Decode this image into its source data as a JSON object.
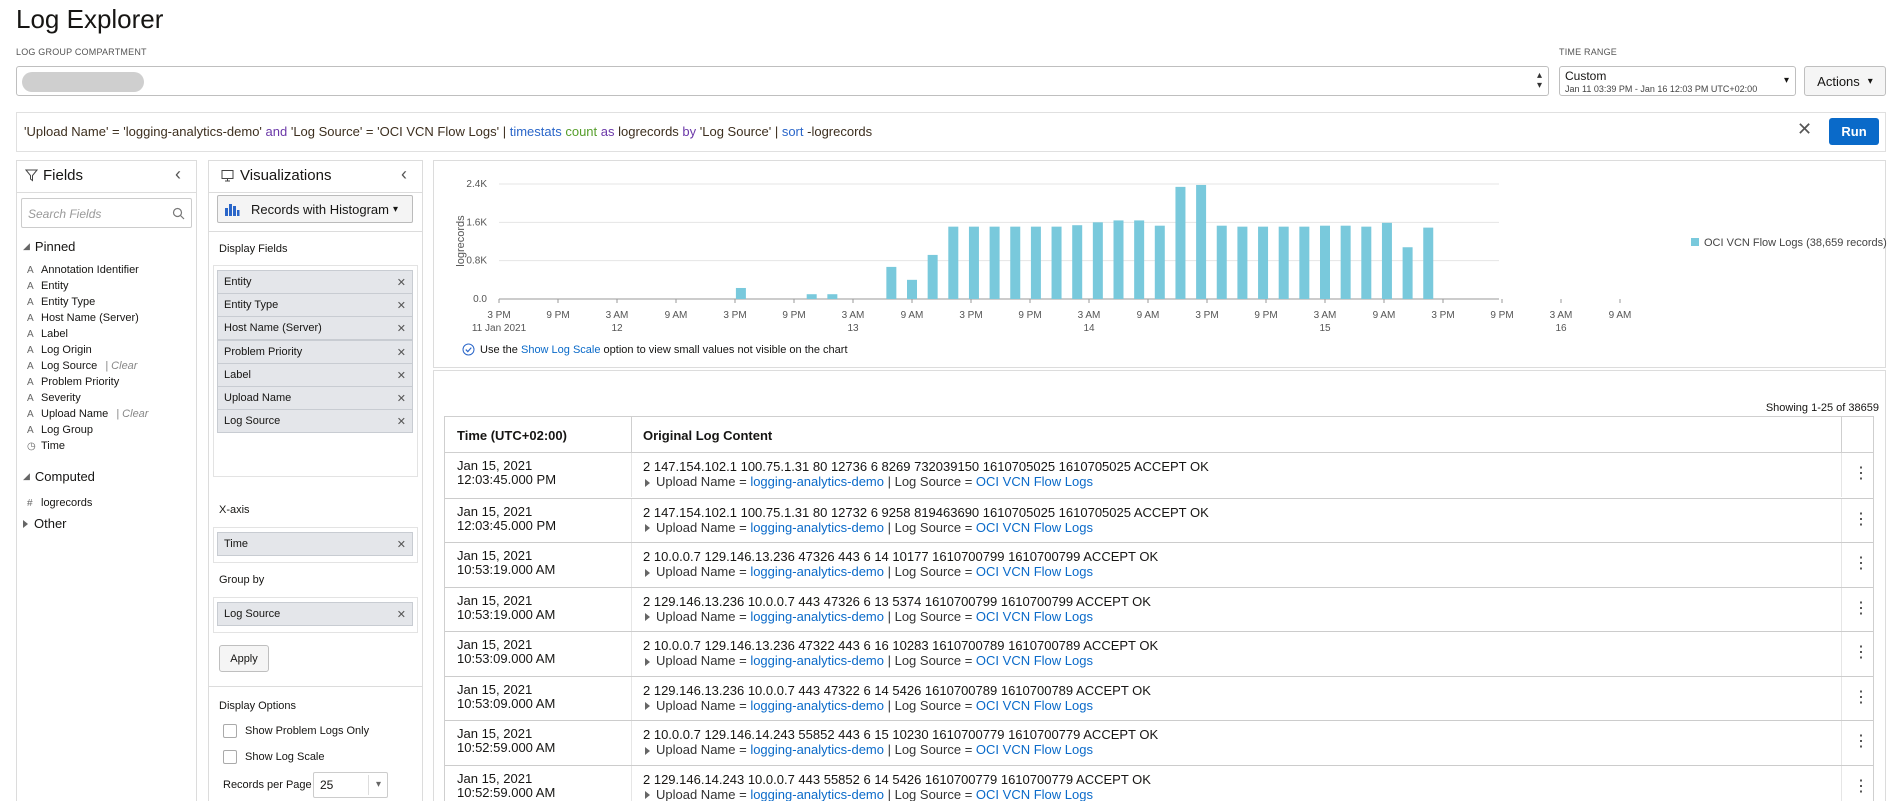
{
  "page_title": "Log Explorer",
  "compartment": {
    "caption": "LOG GROUP COMPARTMENT"
  },
  "time_range": {
    "caption": "TIME RANGE",
    "value": "Custom",
    "detail": "Jan 11 03:39 PM - Jan 16 12:03 PM UTC+02:00"
  },
  "actions_label": "Actions",
  "query": {
    "parts": [
      {
        "t": "'Upload Name' = 'logging-analytics-demo' ",
        "c": "q-str"
      },
      {
        "t": "and ",
        "c": "q-kw"
      },
      {
        "t": "'Log Source' = 'OCI VCN Flow Logs' | ",
        "c": "q-str"
      },
      {
        "t": "timestats ",
        "c": "q-cmd"
      },
      {
        "t": "count ",
        "c": "q-fn"
      },
      {
        "t": "as ",
        "c": "q-kw"
      },
      {
        "t": "logrecords ",
        "c": "q-str"
      },
      {
        "t": "by ",
        "c": "q-kw"
      },
      {
        "t": "'Log Source' | ",
        "c": "q-str"
      },
      {
        "t": "sort ",
        "c": "q-cmd"
      },
      {
        "t": "-logrecords",
        "c": "q-str"
      }
    ],
    "run_label": "Run"
  },
  "fields_panel": {
    "title": "Fields",
    "search_placeholder": "Search Fields",
    "pinned_label": "Pinned",
    "pinned": [
      {
        "name": "Annotation Identifier",
        "type": "A"
      },
      {
        "name": "Entity",
        "type": "A"
      },
      {
        "name": "Entity Type",
        "type": "A"
      },
      {
        "name": "Host Name (Server)",
        "type": "A"
      },
      {
        "name": "Label",
        "type": "A"
      },
      {
        "name": "Log Origin",
        "type": "A"
      },
      {
        "name": "Log Source",
        "type": "A",
        "clear": "| Clear"
      },
      {
        "name": "Problem Priority",
        "type": "A"
      },
      {
        "name": "Severity",
        "type": "A"
      },
      {
        "name": "Upload Name",
        "type": "A",
        "clear": "| Clear"
      },
      {
        "name": "Log Group",
        "type": "A"
      },
      {
        "name": "Time",
        "type": "◷"
      }
    ],
    "computed_label": "Computed",
    "computed": [
      {
        "name": "logrecords",
        "type": "#"
      }
    ],
    "other_label": "Other"
  },
  "viz_panel": {
    "title": "Visualizations",
    "viz_type": "Records with Histogram",
    "display_fields_label": "Display Fields",
    "display_fields": [
      "Entity",
      "Entity Type",
      "Host Name (Server)",
      "Problem Priority",
      "Label",
      "Upload Name",
      "Log Source"
    ],
    "x_axis_label": "X-axis",
    "x_axis_value": "Time",
    "group_by_label": "Group by",
    "group_by_value": "Log Source",
    "apply_label": "Apply",
    "display_options_label": "Display Options",
    "show_problem_logs": "Show Problem Logs Only",
    "show_log_scale": "Show Log Scale",
    "records_per_page_label": "Records per Page",
    "records_per_page": "25"
  },
  "chart_note": {
    "prefix": "Use the ",
    "link": "Show Log Scale",
    "suffix": " option to view small values not visible on the chart"
  },
  "chart_data": {
    "type": "bar",
    "ylabel": "logrecords",
    "yticks": [
      "0.0",
      "0.8K",
      "1.6K",
      "2.4K"
    ],
    "ylim": [
      0,
      2400
    ],
    "series": [
      {
        "name": "OCI VCN Flow Logs (38,659 records)",
        "color": "#79c9dc"
      }
    ],
    "xticks": [
      {
        "label": "3 PM",
        "sub": "11 Jan 2021"
      },
      {
        "label": "9 PM",
        "sub": ""
      },
      {
        "label": "3 AM",
        "sub": "12"
      },
      {
        "label": "9 AM",
        "sub": ""
      },
      {
        "label": "3 PM",
        "sub": ""
      },
      {
        "label": "9 PM",
        "sub": ""
      },
      {
        "label": "3 AM",
        "sub": "13"
      },
      {
        "label": "9 AM",
        "sub": ""
      },
      {
        "label": "3 PM",
        "sub": ""
      },
      {
        "label": "9 PM",
        "sub": ""
      },
      {
        "label": "3 AM",
        "sub": "14"
      },
      {
        "label": "9 AM",
        "sub": ""
      },
      {
        "label": "3 PM",
        "sub": ""
      },
      {
        "label": "9 PM",
        "sub": ""
      },
      {
        "label": "3 AM",
        "sub": "15"
      },
      {
        "label": "9 AM",
        "sub": ""
      },
      {
        "label": "3 PM",
        "sub": ""
      },
      {
        "label": "9 PM",
        "sub": ""
      },
      {
        "label": "3 AM",
        "sub": "16"
      },
      {
        "label": "9 AM",
        "sub": ""
      }
    ],
    "bars": [
      {
        "x": 4.1,
        "v": 230
      },
      {
        "x": 5.3,
        "v": 100
      },
      {
        "x": 5.65,
        "v": 100
      },
      {
        "x": 6.65,
        "v": 670
      },
      {
        "x": 7.0,
        "v": 400
      },
      {
        "x": 7.35,
        "v": 920
      },
      {
        "x": 7.7,
        "v": 1510
      },
      {
        "x": 8.05,
        "v": 1510
      },
      {
        "x": 8.4,
        "v": 1510
      },
      {
        "x": 8.75,
        "v": 1510
      },
      {
        "x": 9.1,
        "v": 1510
      },
      {
        "x": 9.45,
        "v": 1510
      },
      {
        "x": 9.8,
        "v": 1540
      },
      {
        "x": 10.15,
        "v": 1600
      },
      {
        "x": 10.5,
        "v": 1640
      },
      {
        "x": 10.85,
        "v": 1640
      },
      {
        "x": 11.2,
        "v": 1530
      },
      {
        "x": 11.55,
        "v": 2340
      },
      {
        "x": 11.9,
        "v": 2380
      },
      {
        "x": 12.25,
        "v": 1530
      },
      {
        "x": 12.6,
        "v": 1510
      },
      {
        "x": 12.95,
        "v": 1510
      },
      {
        "x": 13.3,
        "v": 1510
      },
      {
        "x": 13.65,
        "v": 1510
      },
      {
        "x": 14.0,
        "v": 1530
      },
      {
        "x": 14.35,
        "v": 1530
      },
      {
        "x": 14.7,
        "v": 1510
      },
      {
        "x": 15.05,
        "v": 1590
      },
      {
        "x": 15.4,
        "v": 1080
      },
      {
        "x": 15.75,
        "v": 1490
      }
    ]
  },
  "table": {
    "showing": "Showing 1-25 of 38659",
    "col_time": "Time (UTC+02:00)",
    "col_content": "Original Log Content",
    "meta_upload_key": "Upload Name = ",
    "meta_upload_val": "logging-analytics-demo",
    "meta_sep": " | Log Source = ",
    "meta_source_val": "OCI VCN Flow Logs",
    "rows": [
      {
        "time": "Jan 15, 2021 12:03:45.000 PM",
        "raw": "2 147.154.102.1 100.75.1.31 80 12736 6 8269 732039150 1610705025 1610705025 ACCEPT OK"
      },
      {
        "time": "Jan 15, 2021 12:03:45.000 PM",
        "raw": "2 147.154.102.1 100.75.1.31 80 12732 6 9258 819463690 1610705025 1610705025 ACCEPT OK"
      },
      {
        "time": "Jan 15, 2021 10:53:19.000 AM",
        "raw": "2 10.0.0.7 129.146.13.236 47326 443 6 14 10177 1610700799 1610700799 ACCEPT OK"
      },
      {
        "time": "Jan 15, 2021 10:53:19.000 AM",
        "raw": "2 129.146.13.236 10.0.0.7 443 47326 6 13 5374 1610700799 1610700799 ACCEPT OK"
      },
      {
        "time": "Jan 15, 2021 10:53:09.000 AM",
        "raw": "2 10.0.0.7 129.146.13.236 47322 443 6 16 10283 1610700789 1610700789 ACCEPT OK"
      },
      {
        "time": "Jan 15, 2021 10:53:09.000 AM",
        "raw": "2 129.146.13.236 10.0.0.7 443 47322 6 14 5426 1610700789 1610700789 ACCEPT OK"
      },
      {
        "time": "Jan 15, 2021 10:52:59.000 AM",
        "raw": "2 10.0.0.7 129.146.14.243 55852 443 6 15 10230 1610700779 1610700779 ACCEPT OK"
      },
      {
        "time": "Jan 15, 2021 10:52:59.000 AM",
        "raw": "2 129.146.14.243 10.0.0.7 443 55852 6 14 5426 1610700779 1610700779 ACCEPT OK"
      }
    ]
  }
}
